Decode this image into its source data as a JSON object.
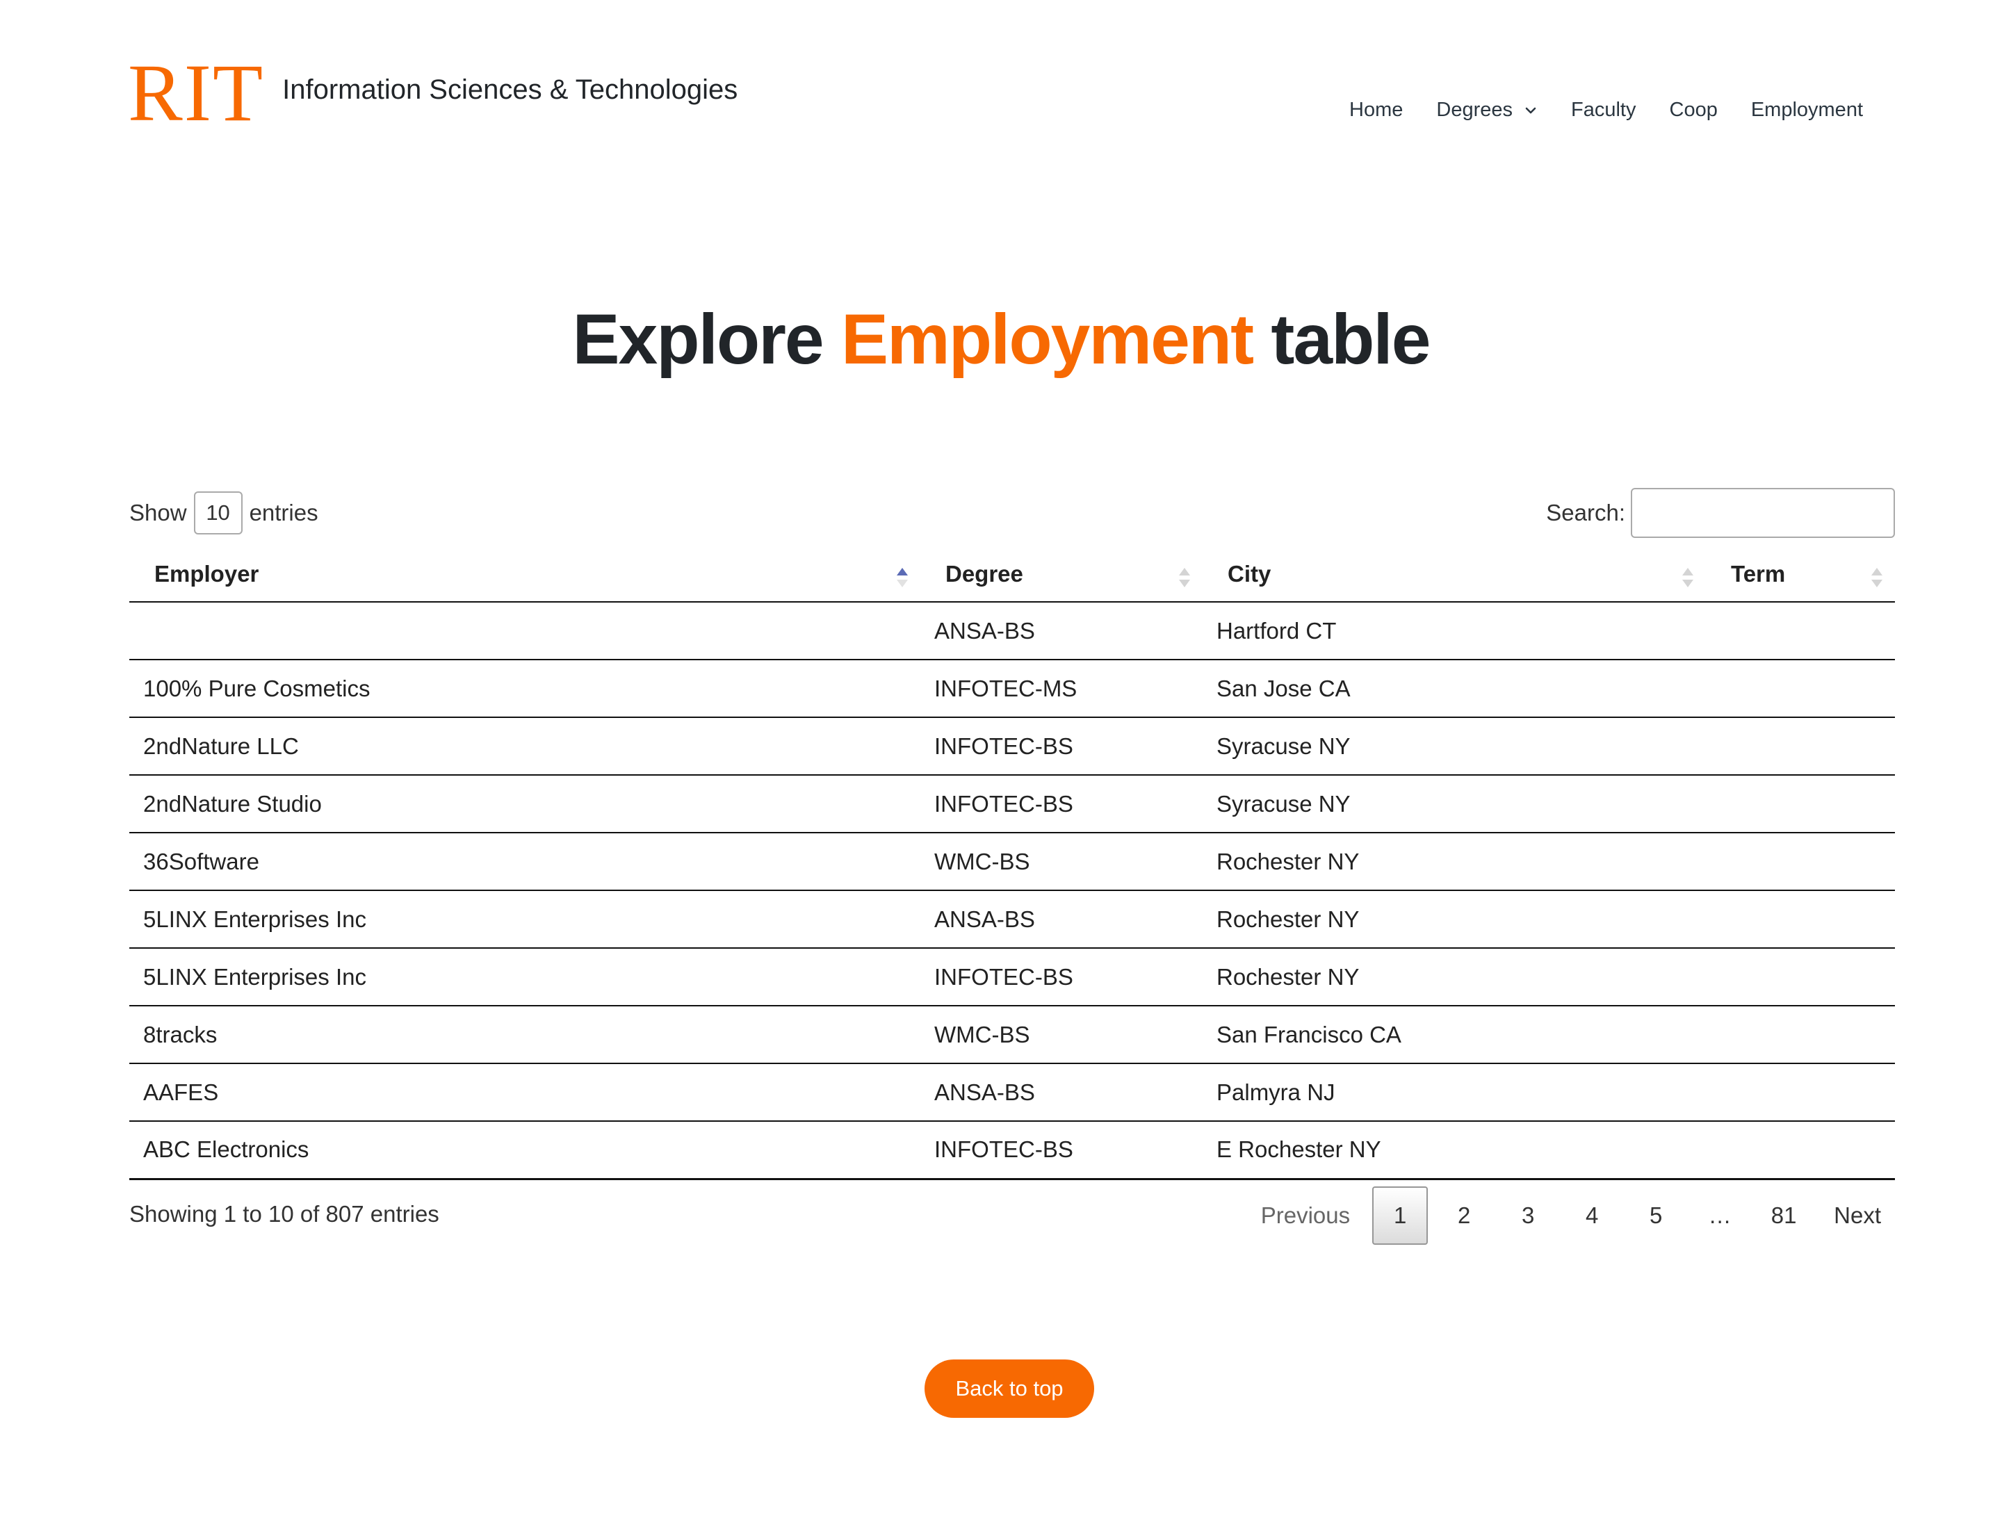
{
  "header": {
    "logo_text": "RIT",
    "site_title": "Information Sciences & Technologies",
    "nav": [
      {
        "label": "Home"
      },
      {
        "label": "Degrees"
      },
      {
        "label": "Faculty"
      },
      {
        "label": "Coop"
      },
      {
        "label": "Employment"
      }
    ]
  },
  "page": {
    "title_prefix": "Explore ",
    "title_accent": "Employment",
    "title_suffix": " table"
  },
  "controls": {
    "show_label": "Show",
    "entries_value": "10",
    "entries_label": "entries",
    "search_label": "Search:",
    "search_value": ""
  },
  "table": {
    "columns": [
      "Employer",
      "Degree",
      "City",
      "Term"
    ],
    "sorted_column": "Employer",
    "sort_direction": "ascending",
    "rows": [
      {
        "employer": "",
        "degree": "ANSA-BS",
        "city": "Hartford CT",
        "term": ""
      },
      {
        "employer": "100% Pure Cosmetics",
        "degree": "INFOTEC-MS",
        "city": "San Jose CA",
        "term": ""
      },
      {
        "employer": "2ndNature LLC",
        "degree": "INFOTEC-BS",
        "city": "Syracuse NY",
        "term": ""
      },
      {
        "employer": "2ndNature Studio",
        "degree": "INFOTEC-BS",
        "city": "Syracuse NY",
        "term": ""
      },
      {
        "employer": "36Software",
        "degree": "WMC-BS",
        "city": "Rochester NY",
        "term": ""
      },
      {
        "employer": "5LINX Enterprises Inc",
        "degree": "ANSA-BS",
        "city": "Rochester NY",
        "term": ""
      },
      {
        "employer": "5LINX Enterprises Inc",
        "degree": "INFOTEC-BS",
        "city": "Rochester NY",
        "term": ""
      },
      {
        "employer": "8tracks",
        "degree": "WMC-BS",
        "city": "San Francisco CA",
        "term": ""
      },
      {
        "employer": "AAFES",
        "degree": "ANSA-BS",
        "city": "Palmyra NJ",
        "term": ""
      },
      {
        "employer": "ABC Electronics",
        "degree": "INFOTEC-BS",
        "city": "E Rochester NY",
        "term": ""
      }
    ]
  },
  "footer": {
    "info": "Showing 1 to 10 of 807 entries",
    "pagination": {
      "previous": "Previous",
      "pages": [
        "1",
        "2",
        "3",
        "4",
        "5"
      ],
      "ellipsis": "…",
      "last": "81",
      "next": "Next",
      "current": "1"
    },
    "back_to_top": "Back to top"
  },
  "colors": {
    "accent": "#f76902",
    "text": "#212529",
    "sort_active": "#5b6bb5",
    "sort_inactive": "#d0d0d0"
  }
}
